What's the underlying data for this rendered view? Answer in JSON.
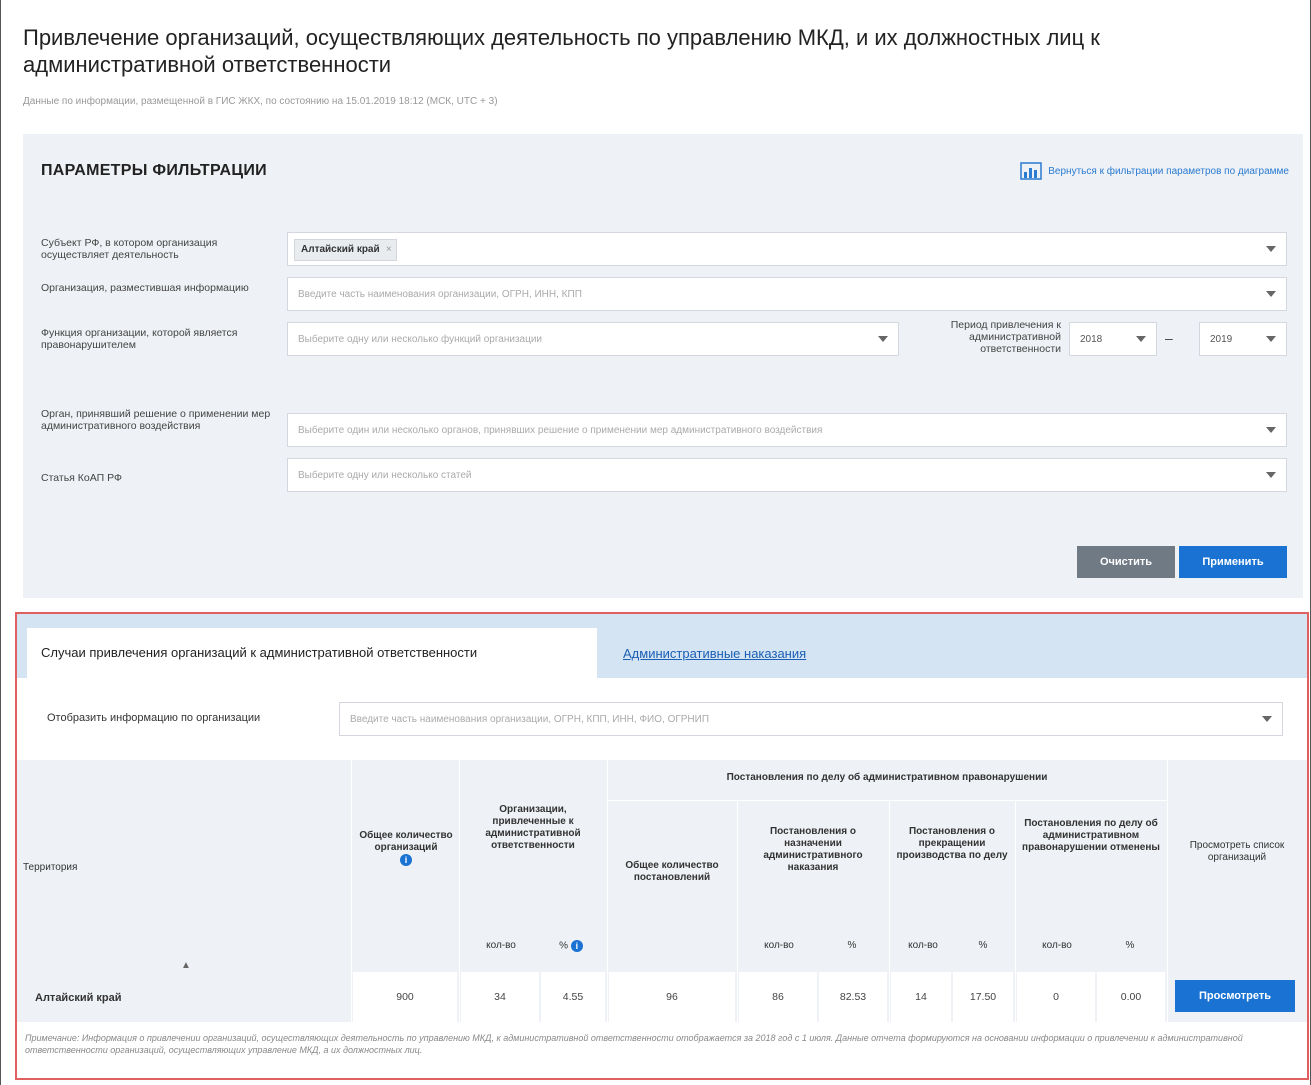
{
  "page": {
    "title": "Привлечение организаций, осуществляющих деятельность по управлению МКД, и их должностных лиц к административной ответственности",
    "subtitle": "Данные по информации, размещенной в ГИС ЖКХ, по состоянию на 15.01.2019 18:12 (МСК, UTC + 3)"
  },
  "filter": {
    "heading": "ПАРАМЕТРЫ ФИЛЬТРАЦИИ",
    "diagram_link": "Вернуться к фильтрации параметров по диаграмме",
    "subject_label": "Субъект РФ, в котором организация осуществляет деятельность",
    "subject_tag": "Алтайский край",
    "org_label": "Организация, разместившая информацию",
    "org_placeholder": "Введите часть наименования организации, ОГРН, ИНН, КПП",
    "function_label": "Функция организации, которой является правонарушителем",
    "function_placeholder": "Выберите одну или несколько функций организации",
    "period_label": "Период привлечения к административной ответственности",
    "period_from": "2018",
    "period_to": "2019",
    "period_dash": "–",
    "organ_label": "Орган, принявший решение о применении мер административного воздействия",
    "organ_placeholder": "Выберите один или несколько органов, принявших решение о применении мер административного воздействия",
    "article_label": "Статья КоАП РФ",
    "article_placeholder": "Выберите одну или несколько статей",
    "clear_button": "Очистить",
    "apply_button": "Применить"
  },
  "results": {
    "tab_active": "Случаи привлечения организаций к административной ответственности",
    "tab_link": "Административные наказания",
    "org_filter_label": "Отобразить информацию по организации",
    "org_filter_placeholder": "Введите часть наименования организации, ОГРН, КПП, ИНН, ФИО, ОГРНИП",
    "table": {
      "col_territory": "Территория",
      "col_total_orgs": "Общее количество организаций",
      "col_orgs_liable": "Организации, привлеченные к административной ответственности",
      "group_resolutions": "Постановления по делу об административном правонарушении",
      "col_total_resolutions": "Общее количество постановлений",
      "col_res_punishment": "Постановления о назначении административного наказания",
      "col_res_termination": "Постановления о прекращении производства по делу",
      "col_res_cancelled": "Постановления по делу об административном правонарушении отменены",
      "col_view_list": "Просмотреть список организаций",
      "sub_count": "кол-во",
      "sub_percent": "%",
      "info_symbol": "i",
      "sort_symbol": "▲",
      "row": {
        "territory": "Алтайский край",
        "total_orgs": "900",
        "liable_count": "34",
        "liable_pct": "4.55",
        "total_resolutions": "96",
        "punishment_count": "86",
        "punishment_pct": "82.53",
        "termination_count": "14",
        "termination_pct": "17.50",
        "cancelled_count": "0",
        "cancelled_pct": "0.00",
        "view_button": "Просмотреть"
      }
    },
    "note": "Примечание: Информация о привлечении организаций, осуществляющих деятельность по управлению МКД, к административной ответственности отображается за 2018 год с 1 июля. Данные отчета формируются на основании информации о привлечении к административной ответственности организаций, осуществляющих управление МКД, а их должностных лиц."
  },
  "colors": {
    "accent": "#1a73d3",
    "panel_bg": "#eef1f5",
    "highlight_border": "#e06060",
    "tab_bar": "#d5e4f2"
  }
}
